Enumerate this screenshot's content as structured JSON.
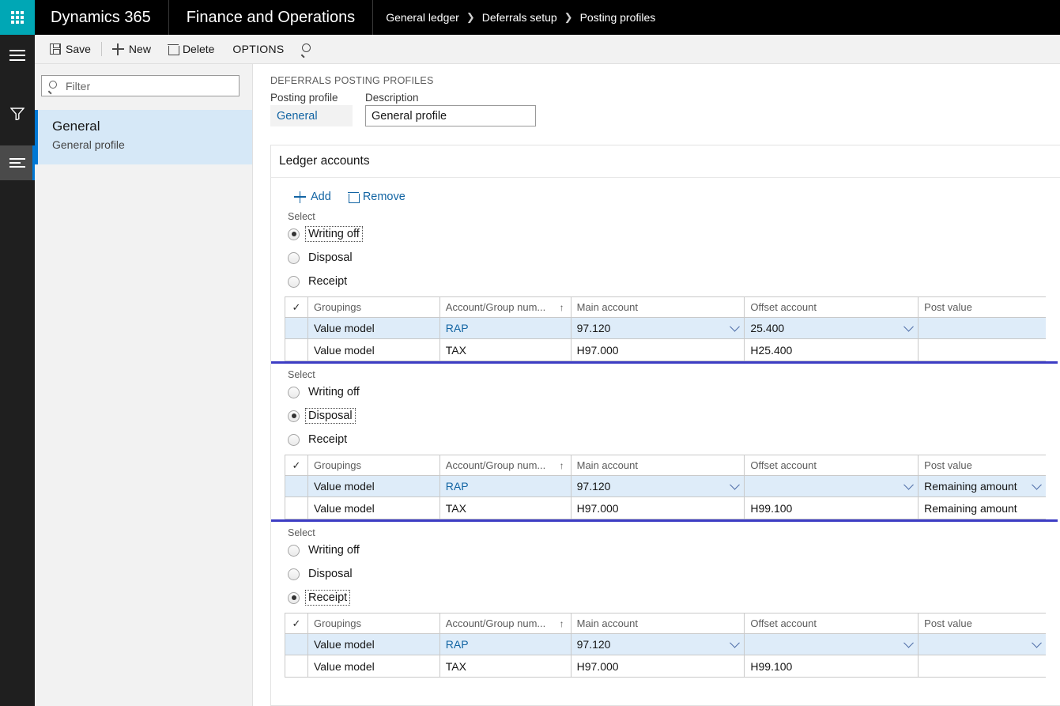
{
  "topbar": {
    "waffle_icon": "waffle-grid-icon",
    "brand": "Dynamics 365",
    "module": "Finance and Operations",
    "breadcrumb": [
      "General ledger",
      "Deferrals setup",
      "Posting profiles"
    ],
    "separator": "❯"
  },
  "navrail": {
    "items": [
      {
        "icon": "hamburger-icon",
        "active": false
      },
      {
        "icon": "filter-funnel-icon",
        "active": false
      },
      {
        "icon": "list-lines-icon",
        "active": true
      }
    ]
  },
  "commandbar": {
    "save_label": "Save",
    "new_label": "New",
    "delete_label": "Delete",
    "options_label": "OPTIONS",
    "search_icon": "search-icon"
  },
  "listpane": {
    "filter_placeholder": "Filter",
    "filter_value": "",
    "items": [
      {
        "title": "General",
        "subtitle": "General profile",
        "selected": true
      }
    ]
  },
  "form": {
    "caption": "DEFERRALS POSTING PROFILES",
    "posting_profile_label": "Posting profile",
    "posting_profile_value": "General",
    "description_label": "Description",
    "description_value": "General profile"
  },
  "card": {
    "title": "Ledger accounts",
    "add_label": "Add",
    "remove_label": "Remove"
  },
  "grid_columns": [
    "",
    "Groupings",
    "Account/Group num...",
    "Main account",
    "Offset account",
    "Post value"
  ],
  "sort_indicator": "↑",
  "select_label": "Select",
  "radio_options": [
    "Writing off",
    "Disposal",
    "Receipt"
  ],
  "sections": [
    {
      "selected_option": "Writing off",
      "rows": [
        {
          "selected": true,
          "groupings": "Value model",
          "account_group": "RAP",
          "main_account": "97.120",
          "offset_account": "25.400",
          "post_value": ""
        },
        {
          "selected": false,
          "groupings": "Value model",
          "account_group": "TAX",
          "main_account": "H97.000",
          "offset_account": "H25.400",
          "post_value": ""
        }
      ]
    },
    {
      "selected_option": "Disposal",
      "rows": [
        {
          "selected": true,
          "groupings": "Value model",
          "account_group": "RAP",
          "main_account": "97.120",
          "offset_account": "",
          "post_value": "Remaining amount"
        },
        {
          "selected": false,
          "groupings": "Value model",
          "account_group": "TAX",
          "main_account": "H97.000",
          "offset_account": "H99.100",
          "post_value": "Remaining amount"
        }
      ]
    },
    {
      "selected_option": "Receipt",
      "rows": [
        {
          "selected": true,
          "groupings": "Value model",
          "account_group": "RAP",
          "main_account": "97.120",
          "offset_account": "",
          "post_value": ""
        },
        {
          "selected": false,
          "groupings": "Value model",
          "account_group": "TAX",
          "main_account": "H97.000",
          "offset_account": "H99.100",
          "post_value": ""
        }
      ]
    }
  ],
  "colors": {
    "brand_teal": "#00A7B5",
    "topbar_black": "#000000",
    "accent_blue": "#0078d4",
    "link_blue": "#1264a3",
    "row_selected": "#deecf9",
    "section_divider": "#3d3dc4"
  }
}
